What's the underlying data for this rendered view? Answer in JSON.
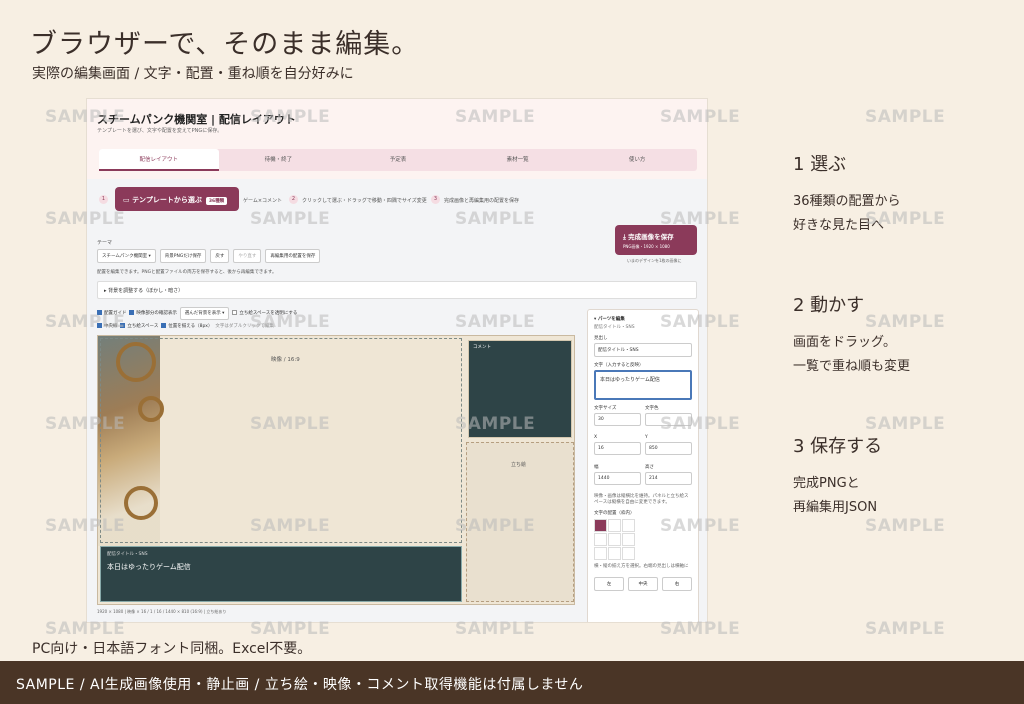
{
  "headline": "ブラウザーで、そのまま編集。",
  "subline": "実際の編集画面 / 文字・配置・重ね順を自分好みに",
  "footnote": "PC向け・日本語フォント同梱。Excel不要。",
  "bottom_bar": "SAMPLE / AI生成画像使用・静止画 / 立ち絵・映像・コメント取得機能は付属しません",
  "watermark": "SAMPLE",
  "steps": [
    {
      "title": "1  選ぶ",
      "desc": "36種類の配置から\n好きな見た目へ"
    },
    {
      "title": "2  動かす",
      "desc": "画面をドラッグ。\n一覧で重ね順も変更"
    },
    {
      "title": "3  保存する",
      "desc": "完成PNGと\n再編集用JSON"
    }
  ],
  "app": {
    "title": "スチームパンク機関室 | 配信レイアウト",
    "subtitle": "テンプレートを選び、文字や配置を変えてPNGに保存。",
    "tabs": [
      "配信レイアウト",
      "待機・終了",
      "予定表",
      "素材一覧",
      "使い方"
    ],
    "step_nums": [
      "1",
      "2",
      "3"
    ],
    "template_button": "テンプレートから選ぶ",
    "template_badge": "36種類",
    "step_texts": [
      "ゲーム×コメント",
      "クリックして選ぶ・ドラッグで移動・四隅でサイズ変更",
      "完成画像と再編集用の配置を保存"
    ],
    "save_button": "完成画像を保存",
    "save_sub": "PNG画像・1920 × 1080",
    "save_note": "いまのデザインを1枚の画像に",
    "theme_label": "テーマ",
    "theme_select": "スチームパンク機関室",
    "ctrl_buttons": [
      "背景PNGだけ保存",
      "戻す",
      "やり直す",
      "再編集用の配置を保存"
    ],
    "hint": "配置を編集できます。PNGと配置ファイルの両方を保存すると、後から再編集できます。",
    "bg_adjust": "▸ 背景を調整する（ぼかし・暗さ）",
    "checks": [
      "配置ガイド",
      "映像部分の確認表示",
      "選んだ背景を表示",
      "立ち絵スペースを透明にする",
      "中央線",
      "立ち絵スペース",
      "位置を揃える（8px）",
      "文字はダブルクリックで編集"
    ],
    "video_label": "映像 / 16:9",
    "comment_label": "コメント",
    "stand_label": "立ち絵",
    "title_small": "配信タイトル・SNS",
    "title_main": "本日はゆったりゲーム配信",
    "canvas_status": "1920 × 1080 | 映像 × 16 / 1 / 16 / 1440 × 810 (16:9) | 立ち絵あり"
  },
  "panel": {
    "header": "▾ パーツを編集",
    "sub": "配信タイトル・SNS",
    "name_label": "見出し",
    "name_value": "配信タイトル・SNS",
    "text_label": "文字（入力すると反映）",
    "text_value": "本日はゆったりゲーム配信",
    "size_label": "文字サイズ",
    "size_value": "30",
    "color_label": "文字色",
    "x_label": "X",
    "x_value": "16",
    "y_label": "Y",
    "y_value": "850",
    "w_label": "幅",
    "w_value": "1440",
    "h_label": "高さ",
    "h_value": "214",
    "note": "映像・画像は縦横比を維持。パネルと立ち絵スペースは縦横を自由に変更できます。",
    "align_label": "文字の配置（枠内）",
    "align_note": "横・縦の揃え方を選択。右端の見出しは横軸に",
    "align_buttons": [
      "左",
      "中央",
      "右"
    ]
  }
}
